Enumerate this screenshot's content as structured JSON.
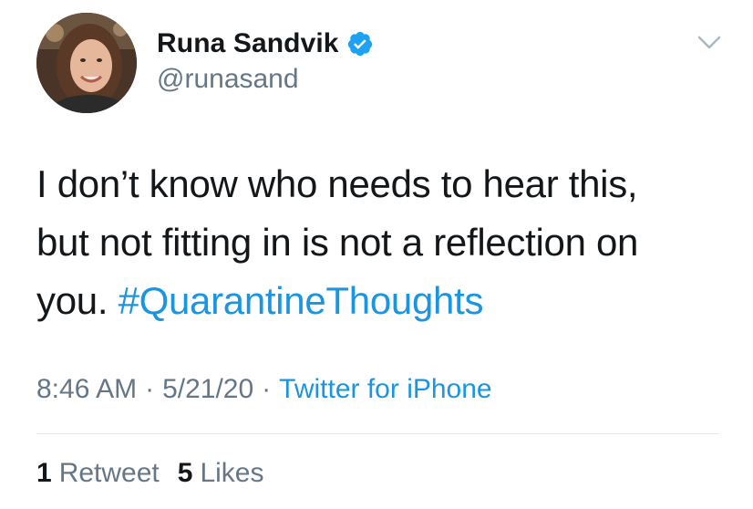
{
  "user": {
    "display_name": "Runa Sandvik",
    "handle": "@runasand",
    "verified_icon": "verified-badge-icon",
    "avatar_icon": "profile-photo"
  },
  "tweet": {
    "text_line_1": "I don’t know who needs to hear this,",
    "text_line_2": "but not fitting in is not a reflection on",
    "text_line_3_prefix": "you. ",
    "hashtag": "#QuarantineThoughts"
  },
  "meta": {
    "time": "8:46 AM",
    "separator": "·",
    "date": "5/21/20",
    "source": "Twitter for iPhone"
  },
  "stats": {
    "retweets_count": "1",
    "retweets_label": "Retweet",
    "likes_count": "5",
    "likes_label": "Likes"
  },
  "menu": {
    "caret_icon": "chevron-down-icon"
  },
  "colors": {
    "text": "#14171a",
    "secondary": "#657786",
    "link": "#1b95e0",
    "divider": "#e1e8ed"
  }
}
